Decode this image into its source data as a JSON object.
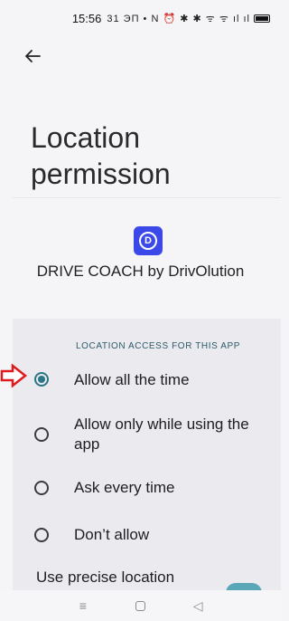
{
  "status_bar": {
    "time": "15:56",
    "icons_text": "31 ЭП • N ⏰ ✱ ✱ ᯤ ᯤ ıl ıl"
  },
  "header": {
    "back_icon": "arrow-left-icon",
    "title": "Location permission"
  },
  "app": {
    "icon_letter": "D",
    "name": "DRIVE COACH by DrivOlution",
    "icon_color": "#3b49e8"
  },
  "location_access": {
    "header": "LOCATION ACCESS FOR THIS APP",
    "options": [
      {
        "label": "Allow all the time",
        "selected": true
      },
      {
        "label": "Allow only while using the app",
        "selected": false
      },
      {
        "label": "Ask every time",
        "selected": false
      },
      {
        "label": "Don’t allow",
        "selected": false
      }
    ]
  },
  "precise": {
    "label": "Use precise location"
  },
  "colors": {
    "accent": "#2a7687",
    "annotation_arrow": "#e01b1b"
  },
  "nav": {
    "menu_icon": "menu-icon",
    "home_icon": "home-icon",
    "back_icon": "back-triangle-icon"
  }
}
